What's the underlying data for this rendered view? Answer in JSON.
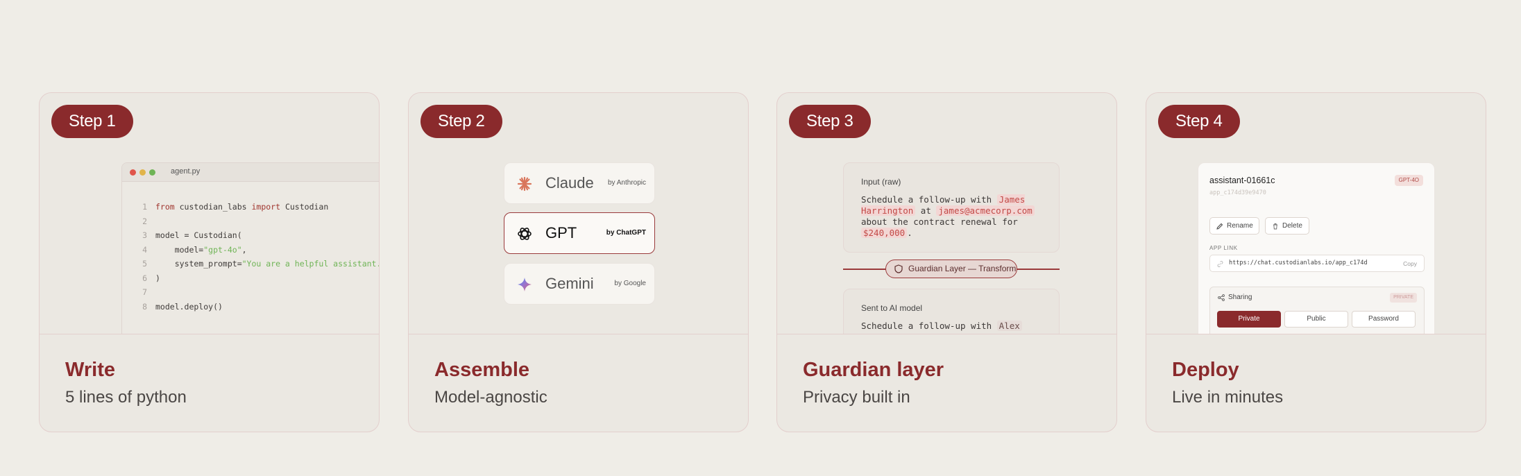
{
  "colors": {
    "accent": "#8a2a2c",
    "background": "#efede7",
    "card": "#ebe8e2"
  },
  "cards": [
    {
      "step": "Step 1",
      "title": "Write",
      "subtitle": "5 lines of python"
    },
    {
      "step": "Step 2",
      "title": "Assemble",
      "subtitle": "Model-agnostic"
    },
    {
      "step": "Step 3",
      "title": "Guardian layer",
      "subtitle": "Privacy built in"
    },
    {
      "step": "Step 4",
      "title": "Deploy",
      "subtitle": "Live in minutes"
    }
  ],
  "editor": {
    "filename": "agent.py",
    "lines": [
      {
        "n": "1",
        "parts": [
          {
            "t": "from",
            "c": "kw"
          },
          {
            "t": " custodian_labs "
          },
          {
            "t": "import",
            "c": "kw"
          },
          {
            "t": " Custodian"
          }
        ]
      },
      {
        "n": "2",
        "parts": []
      },
      {
        "n": "3",
        "parts": [
          {
            "t": "model = Custodian("
          }
        ]
      },
      {
        "n": "4",
        "parts": [
          {
            "t": "    model="
          },
          {
            "t": "\"gpt-4o\"",
            "c": "str"
          },
          {
            "t": ","
          }
        ]
      },
      {
        "n": "5",
        "parts": [
          {
            "t": "    system_prompt="
          },
          {
            "t": "\"You are a helpful assistant.\"",
            "c": "str"
          }
        ]
      },
      {
        "n": "6",
        "parts": [
          {
            "t": ")"
          }
        ]
      },
      {
        "n": "7",
        "parts": []
      },
      {
        "n": "8",
        "parts": [
          {
            "t": "model.deploy()"
          }
        ]
      }
    ]
  },
  "models": [
    {
      "name": "Claude",
      "by": "by Anthropic",
      "icon": "claude-icon",
      "active": false
    },
    {
      "name": "GPT",
      "by": "by ChatGPT",
      "icon": "openai-icon",
      "active": true
    },
    {
      "name": "Gemini",
      "by": "by Google",
      "icon": "gemini-icon",
      "active": false
    }
  ],
  "guardian": {
    "input_label": "Input (raw)",
    "input_text": {
      "before": "Schedule a follow-up with ",
      "name": "James Harrington",
      "mid": " at ",
      "email": "james@acmecorp.com",
      "mid2": " about the contract renewal for ",
      "amount": "$240,000",
      "end": "."
    },
    "layer_label": "Guardian Layer — Transform",
    "sent_label": "Sent to AI model",
    "sent_text": {
      "before": "Schedule a follow-up with ",
      "name": "Alex"
    }
  },
  "deploy": {
    "title": "assistant-01661c",
    "id": "app_c174d39e9470",
    "badge": "GPT-4O",
    "rename_label": "Rename",
    "delete_label": "Delete",
    "app_link_label": "APP LINK",
    "app_link": "https://chat.custodianlabs.io/app_c174d",
    "copy_label": "Copy",
    "sharing_label": "Sharing",
    "sharing_badge": "PRIVATE",
    "sharing_options": [
      "Private",
      "Public",
      "Password"
    ],
    "sharing_selected": "Private"
  }
}
